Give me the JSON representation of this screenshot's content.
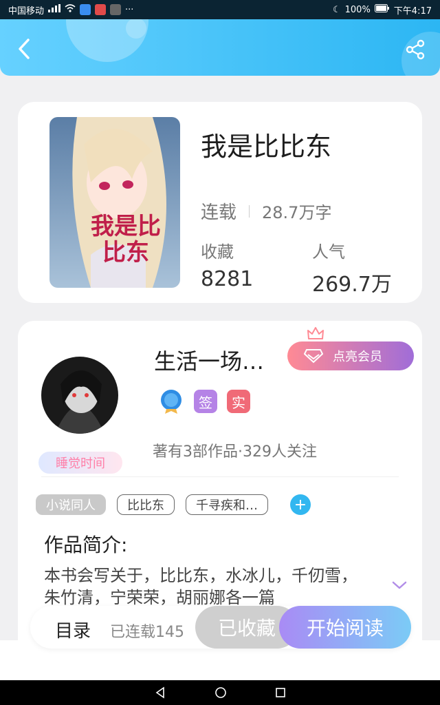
{
  "status_bar": {
    "carrier": "中国移动",
    "battery": "100%",
    "time": "下午4:17"
  },
  "header": {
    "back_icon": "chevron-left-icon",
    "share_icon": "share-icon"
  },
  "book": {
    "title": "我是比比东",
    "status": "连载",
    "word_count": "28.7万字",
    "favorites_label": "收藏",
    "favorites_value": "8281",
    "popularity_label": "人气",
    "popularity_value": "269.7万",
    "cover_title": "我是比比东"
  },
  "author": {
    "name": "生活一场…",
    "frame_tag": "睡觉时间",
    "vip_label": "点亮会员",
    "badge_sign": "签",
    "badge_real": "实",
    "works_line": "著有3部作品·329人关注"
  },
  "tags": {
    "items": [
      "小说同人",
      "比比东",
      "千寻疾和…"
    ],
    "add": "+"
  },
  "intro": {
    "title": "作品简介:",
    "text": "本书会写关于，比比东，水冰儿，千仞雪，朱竹清，宁荣荣，胡丽娜各一篇"
  },
  "actions": {
    "toc_label": "目录",
    "toc_count": "已连载145",
    "favorited": "已收藏",
    "read": "开始阅读"
  },
  "colors": {
    "header_start": "#66d1ff",
    "header_end": "#2cb6f3",
    "vip_start": "#ff8a94",
    "vip_end": "#a06dd8",
    "read_start": "#a98bf5",
    "read_end": "#7bcbf6",
    "sign_chip": "#b583e6",
    "real_chip": "#f06a77"
  }
}
